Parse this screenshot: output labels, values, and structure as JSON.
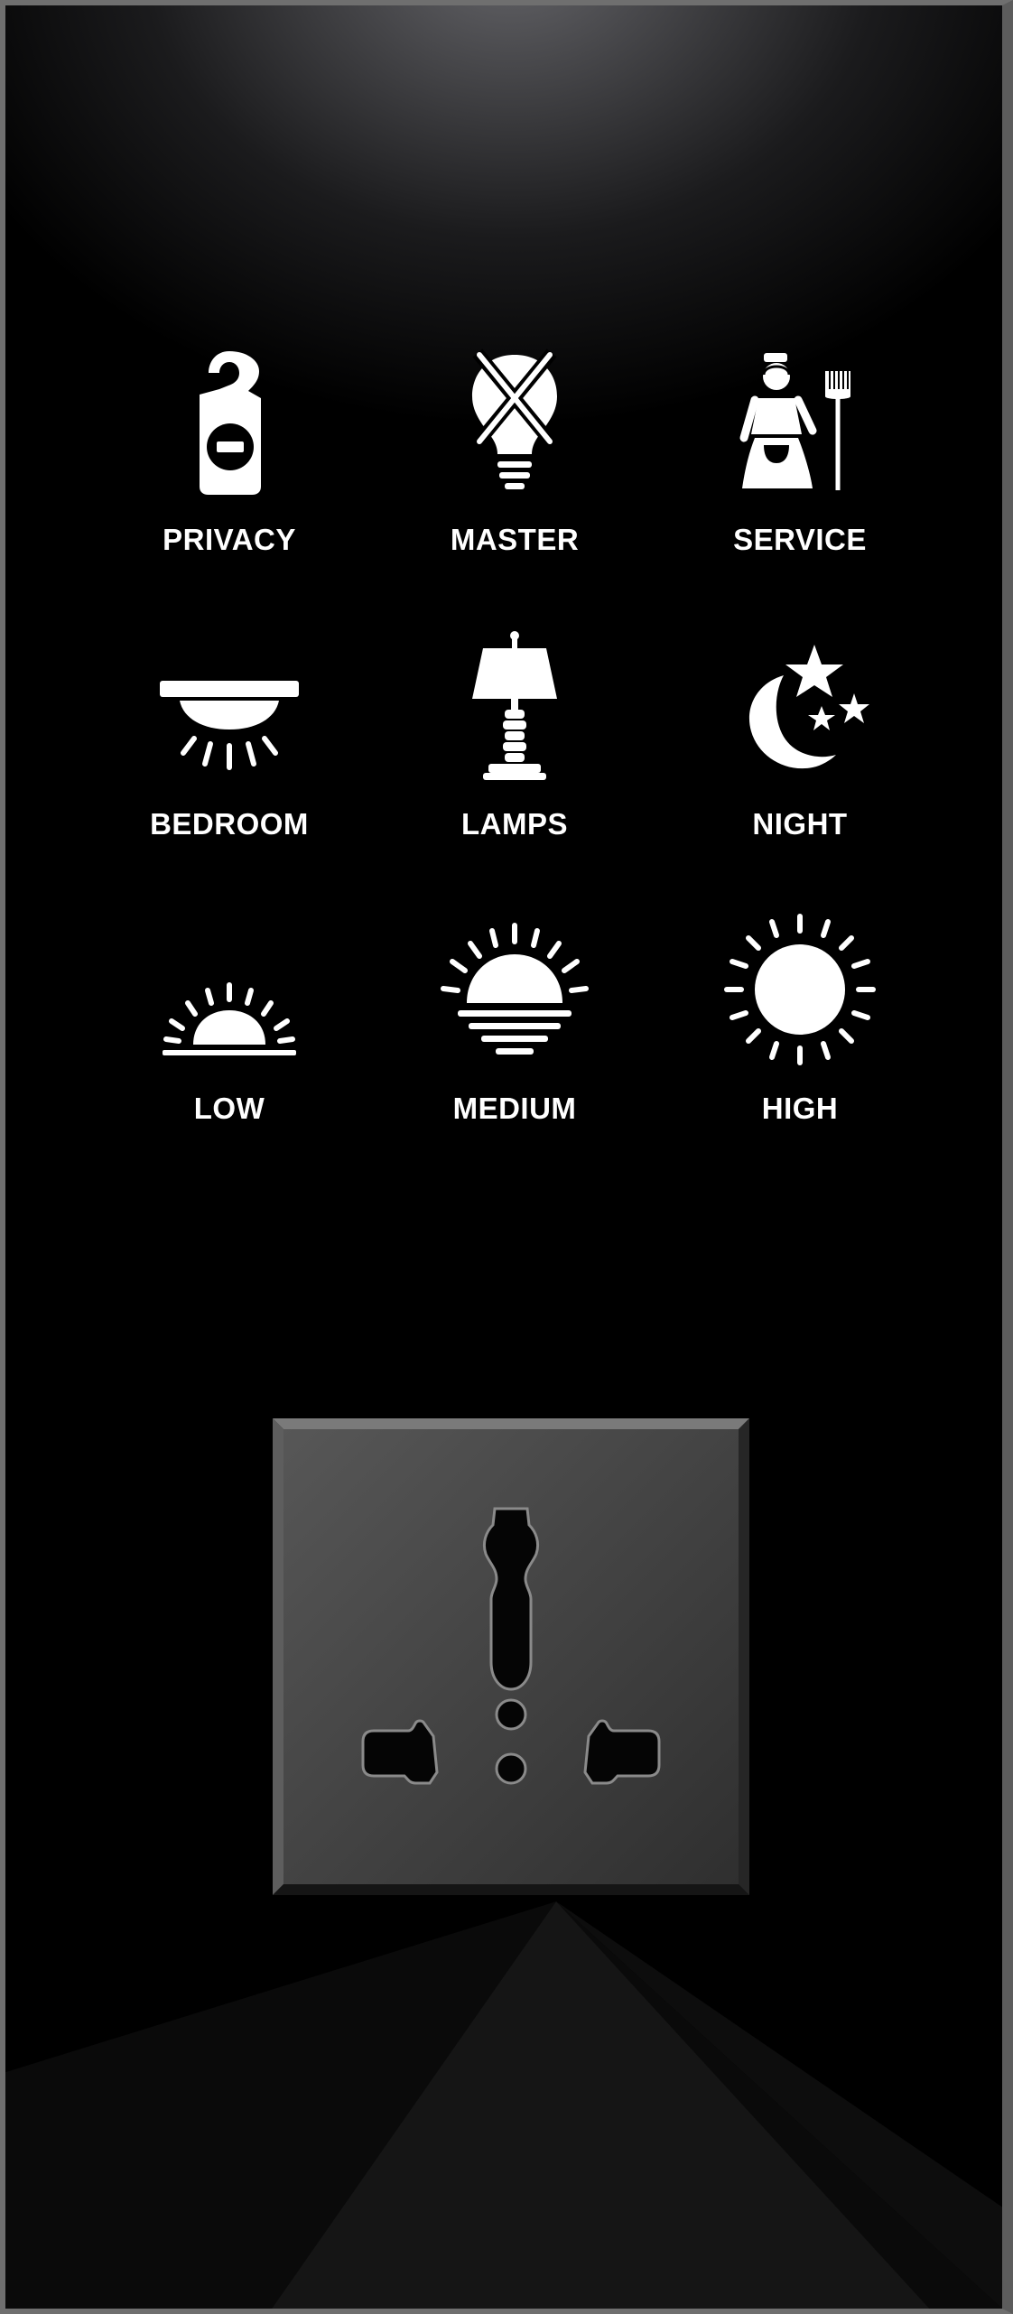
{
  "panel": {
    "buttons": [
      {
        "label": "PRIVACY",
        "icon": "do-not-disturb-hanger-icon"
      },
      {
        "label": "MASTER",
        "icon": "master-off-bulb-icon"
      },
      {
        "label": "SERVICE",
        "icon": "maid-service-icon"
      },
      {
        "label": "BEDROOM",
        "icon": "ceiling-light-icon"
      },
      {
        "label": "LAMPS",
        "icon": "table-lamp-icon"
      },
      {
        "label": "NIGHT",
        "icon": "moon-stars-icon"
      },
      {
        "label": "LOW",
        "icon": "sunrise-low-icon"
      },
      {
        "label": "MEDIUM",
        "icon": "half-sun-medium-icon"
      },
      {
        "label": "HIGH",
        "icon": "full-sun-high-icon"
      }
    ],
    "socket": {
      "type": "universal-power-socket"
    },
    "colors": {
      "background": "#000000",
      "icon": "#ffffff",
      "socket_plate": "#3f3f3f",
      "frame": "#6f6f6f"
    }
  }
}
